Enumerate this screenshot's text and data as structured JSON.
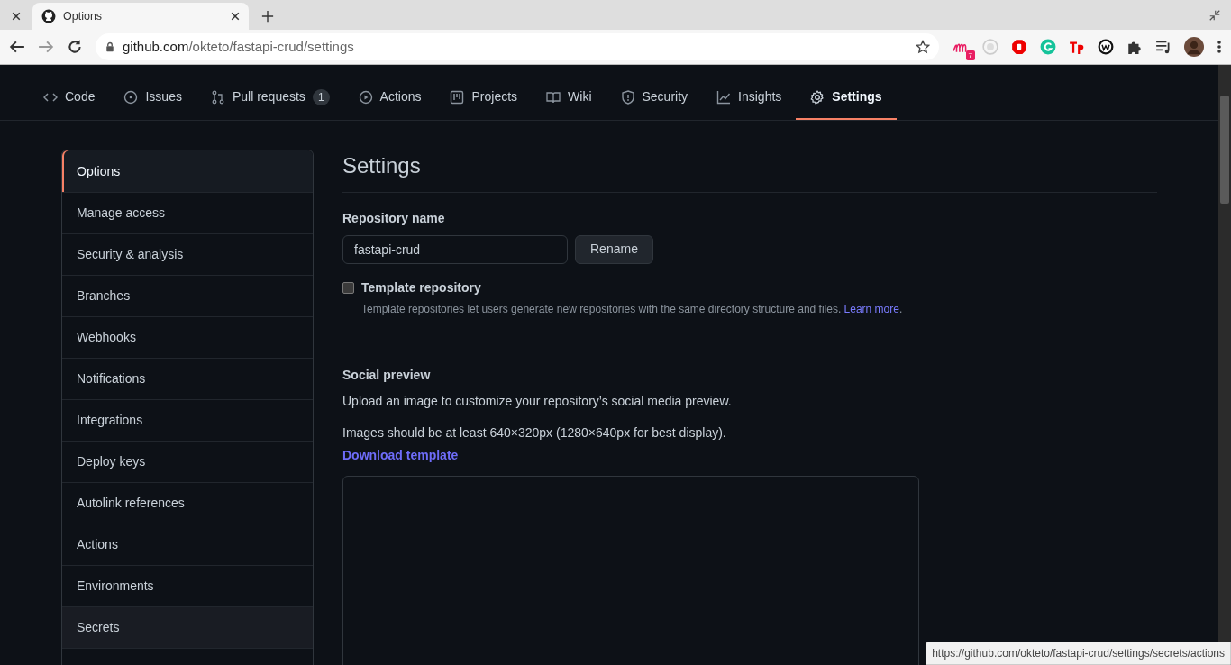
{
  "browser": {
    "tabs": [
      {
        "selected": false
      },
      {
        "title": "Options",
        "selected": true
      }
    ],
    "address": {
      "host": "github.com",
      "path": "/okteto/fastapi-crud/settings"
    },
    "extension_badge": "7"
  },
  "repo_nav": [
    {
      "label": "Code",
      "selected": false
    },
    {
      "label": "Issues",
      "selected": false
    },
    {
      "label": "Pull requests",
      "count": "1",
      "selected": false
    },
    {
      "label": "Actions",
      "selected": false
    },
    {
      "label": "Projects",
      "selected": false
    },
    {
      "label": "Wiki",
      "selected": false
    },
    {
      "label": "Security",
      "selected": false
    },
    {
      "label": "Insights",
      "selected": false
    },
    {
      "label": "Settings",
      "selected": true
    }
  ],
  "sidebar": {
    "items": [
      {
        "label": "Options",
        "selected": true,
        "hovered": false
      },
      {
        "label": "Manage access",
        "selected": false,
        "hovered": false
      },
      {
        "label": "Security & analysis",
        "selected": false,
        "hovered": false
      },
      {
        "label": "Branches",
        "selected": false,
        "hovered": false
      },
      {
        "label": "Webhooks",
        "selected": false,
        "hovered": false
      },
      {
        "label": "Notifications",
        "selected": false,
        "hovered": false
      },
      {
        "label": "Integrations",
        "selected": false,
        "hovered": false
      },
      {
        "label": "Deploy keys",
        "selected": false,
        "hovered": false
      },
      {
        "label": "Autolink references",
        "selected": false,
        "hovered": false
      },
      {
        "label": "Actions",
        "selected": false,
        "hovered": false
      },
      {
        "label": "Environments",
        "selected": false,
        "hovered": false
      },
      {
        "label": "Secrets",
        "selected": false,
        "hovered": true
      }
    ]
  },
  "settings": {
    "title": "Settings",
    "repo_name": {
      "label": "Repository name",
      "value": "fastapi-crud",
      "button": "Rename"
    },
    "template": {
      "label": "Template repository",
      "checked": false,
      "help": "Template repositories let users generate new repositories with the same directory structure and files.",
      "link": "Learn more",
      "after_link": "."
    },
    "social": {
      "title": "Social preview",
      "lines": [
        "Upload an image to customize your repository’s social media preview.",
        "Images should be at least 640×320px (1280×640px for best display)."
      ],
      "link": "Download template"
    }
  },
  "status_url": "https://github.com/okteto/fastapi-crud/settings/secrets/actions"
}
